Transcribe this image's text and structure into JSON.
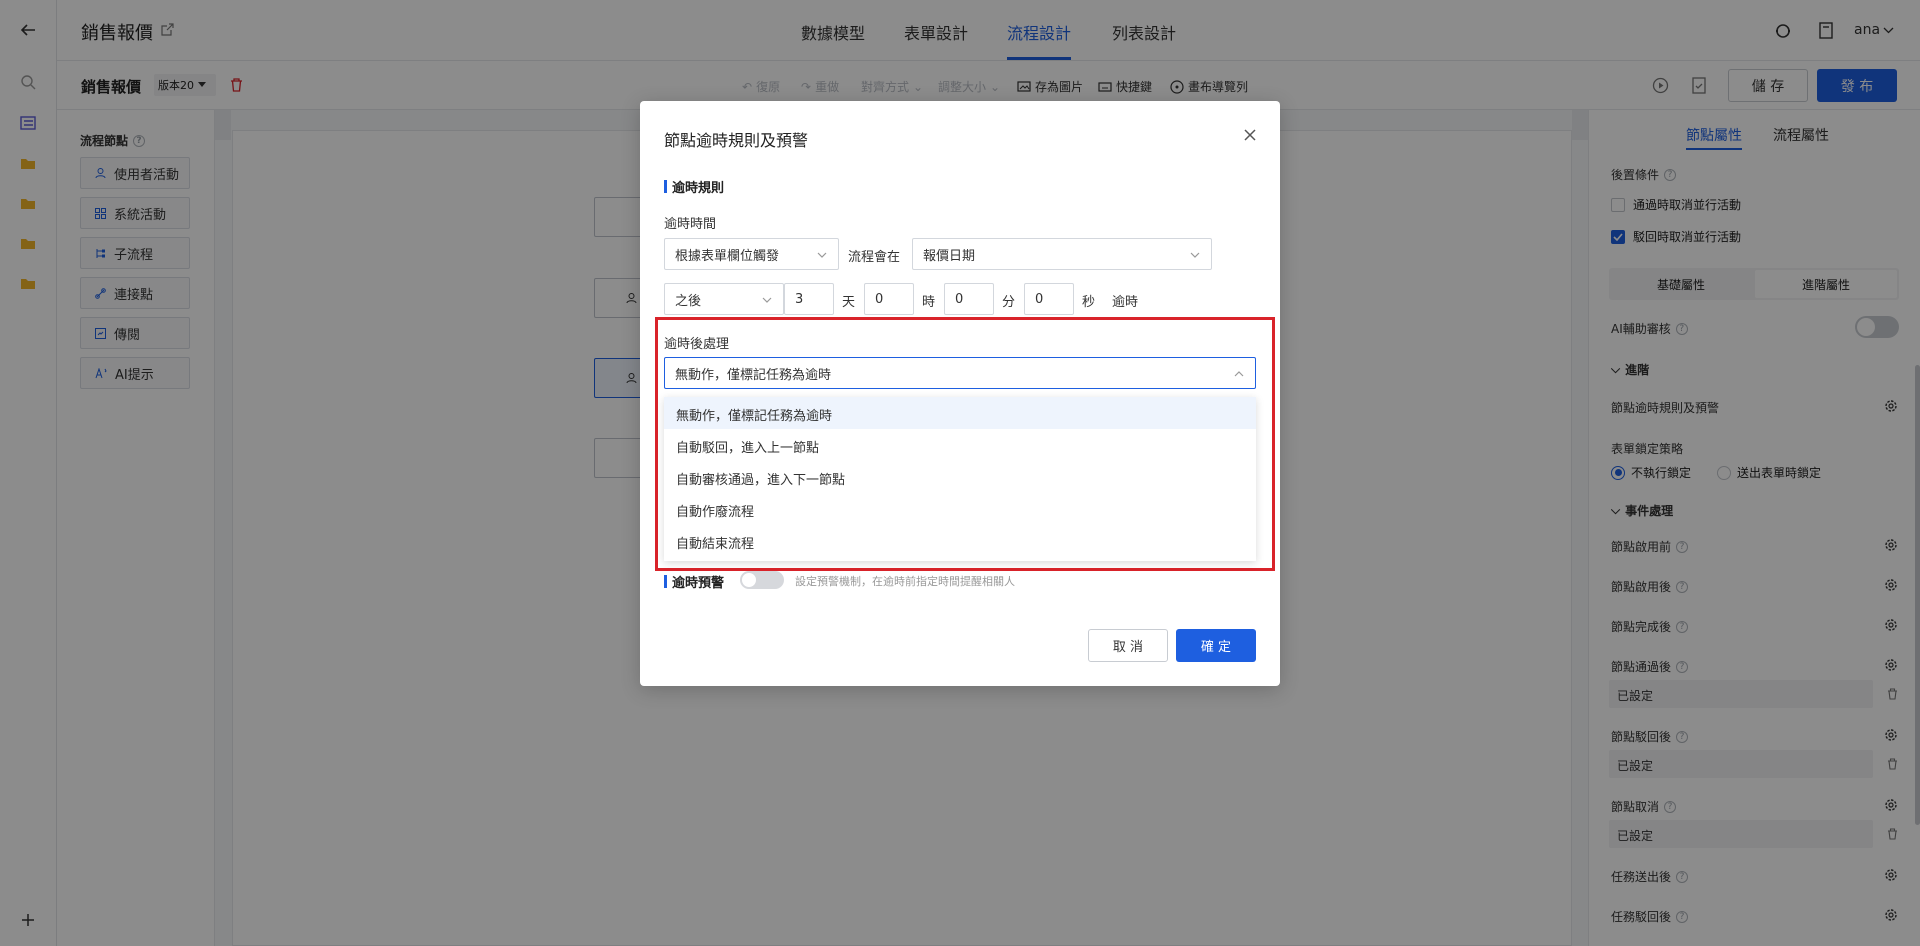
{
  "header": {
    "title": "銷售報價",
    "tabs": [
      "數據模型",
      "表單設計",
      "流程設計",
      "列表設計"
    ],
    "active_tab": "流程設計",
    "user": "ana"
  },
  "toolbar": {
    "name": "銷售報價",
    "version": "版本20",
    "undo": "復原",
    "redo": "重做",
    "align": "對齊方式",
    "resize": "調整大小",
    "save_image": "存為圖片",
    "shortcuts": "快捷鍵",
    "canvas_nav": "畫布導覽列",
    "save": "儲 存",
    "publish": "發 布"
  },
  "palette": {
    "title": "流程節點",
    "items": [
      "使用者活動",
      "系統活動",
      "子流程",
      "連接點",
      "傳閱",
      "AI提示"
    ]
  },
  "right_panel": {
    "tabs": [
      "節點屬性",
      "流程屬性"
    ],
    "post_condition": "後置條件",
    "checks": [
      {
        "label": "通過時取消並行活動",
        "checked": false
      },
      {
        "label": "駁回時取消並行活動",
        "checked": true
      }
    ],
    "sub_tabs": [
      "基礎屬性",
      "進階屬性"
    ],
    "ai_review": "AI輔助審核",
    "advanced": "進階",
    "timeout_rule": "節點逾時規則及預警",
    "lock_strategy": "表單鎖定策略",
    "lock_options": [
      "不執行鎖定",
      "送出表單時鎖定"
    ],
    "event_section": "事件處理",
    "events": [
      {
        "label": "節點啟用前",
        "value": ""
      },
      {
        "label": "節點啟用後",
        "value": ""
      },
      {
        "label": "節點完成後",
        "value": ""
      },
      {
        "label": "節點通過後",
        "value": "已設定"
      },
      {
        "label": "節點駁回後",
        "value": "已設定"
      },
      {
        "label": "節點取消",
        "value": "已設定"
      },
      {
        "label": "任務送出後",
        "value": ""
      },
      {
        "label": "任務駁回後",
        "value": ""
      }
    ]
  },
  "modal": {
    "title": "節點逾時規則及預警",
    "rule_section": "逾時規則",
    "timeout_time_label": "逾時時間",
    "trigger": "根據表單欄位觸發",
    "flow_at": "流程會在",
    "date_field": "報價日期",
    "after": "之後",
    "days": "3",
    "days_unit": "天",
    "hours": "0",
    "hours_unit": "時",
    "minutes": "0",
    "minutes_unit": "分",
    "seconds": "0",
    "seconds_unit": "秒",
    "timeout_text": "逾時",
    "handling_label": "逾時後處理",
    "handling_value": "無動作，僅標記任務為逾時",
    "options": [
      "無動作，僅標記任務為逾時",
      "自動駁回，進入上一節點",
      "自動審核通過，進入下一節點",
      "自動作廢流程",
      "自動結束流程"
    ],
    "warning_section": "逾時預警",
    "warning_hint": "設定預警機制，在逾時前指定時間提醒相關人",
    "cancel": "取 消",
    "confirm": "確 定"
  },
  "colors": {
    "accent": "#1e5fe0",
    "highlight": "#d9232a"
  }
}
